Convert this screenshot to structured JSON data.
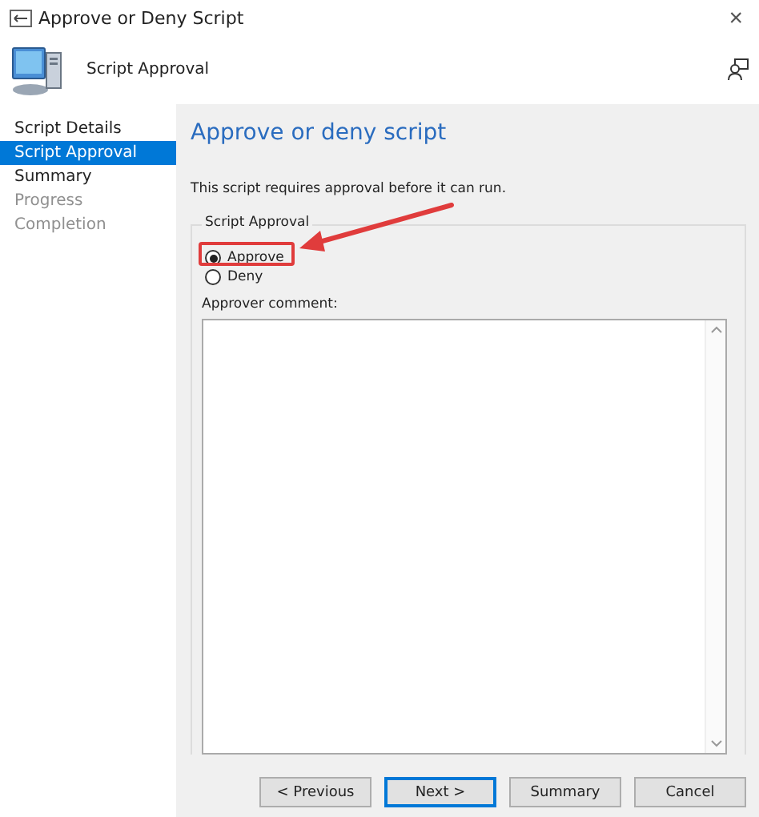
{
  "window": {
    "title": "Approve or Deny Script",
    "close": "×"
  },
  "header": {
    "title": "Script Approval"
  },
  "sidebar": {
    "items": [
      {
        "label": "Script Details",
        "selected": false,
        "disabled": false
      },
      {
        "label": "Script Approval",
        "selected": true,
        "disabled": false
      },
      {
        "label": "Summary",
        "selected": false,
        "disabled": false
      },
      {
        "label": "Progress",
        "selected": false,
        "disabled": true
      },
      {
        "label": "Completion",
        "selected": false,
        "disabled": true
      }
    ]
  },
  "content": {
    "heading": "Approve or deny script",
    "description": "This script requires approval before it can run.",
    "group": {
      "title": "Script Approval",
      "options": [
        {
          "label": "Approve",
          "selected": true,
          "highlighted": true
        },
        {
          "label": "Deny",
          "selected": false,
          "highlighted": false
        }
      ],
      "comment_label": "Approver comment:"
    }
  },
  "buttons": [
    {
      "label": "< Previous",
      "default": false
    },
    {
      "label": "Next >",
      "default": true
    },
    {
      "label": "Summary",
      "default": false
    },
    {
      "label": "Cancel",
      "default": false
    }
  ]
}
